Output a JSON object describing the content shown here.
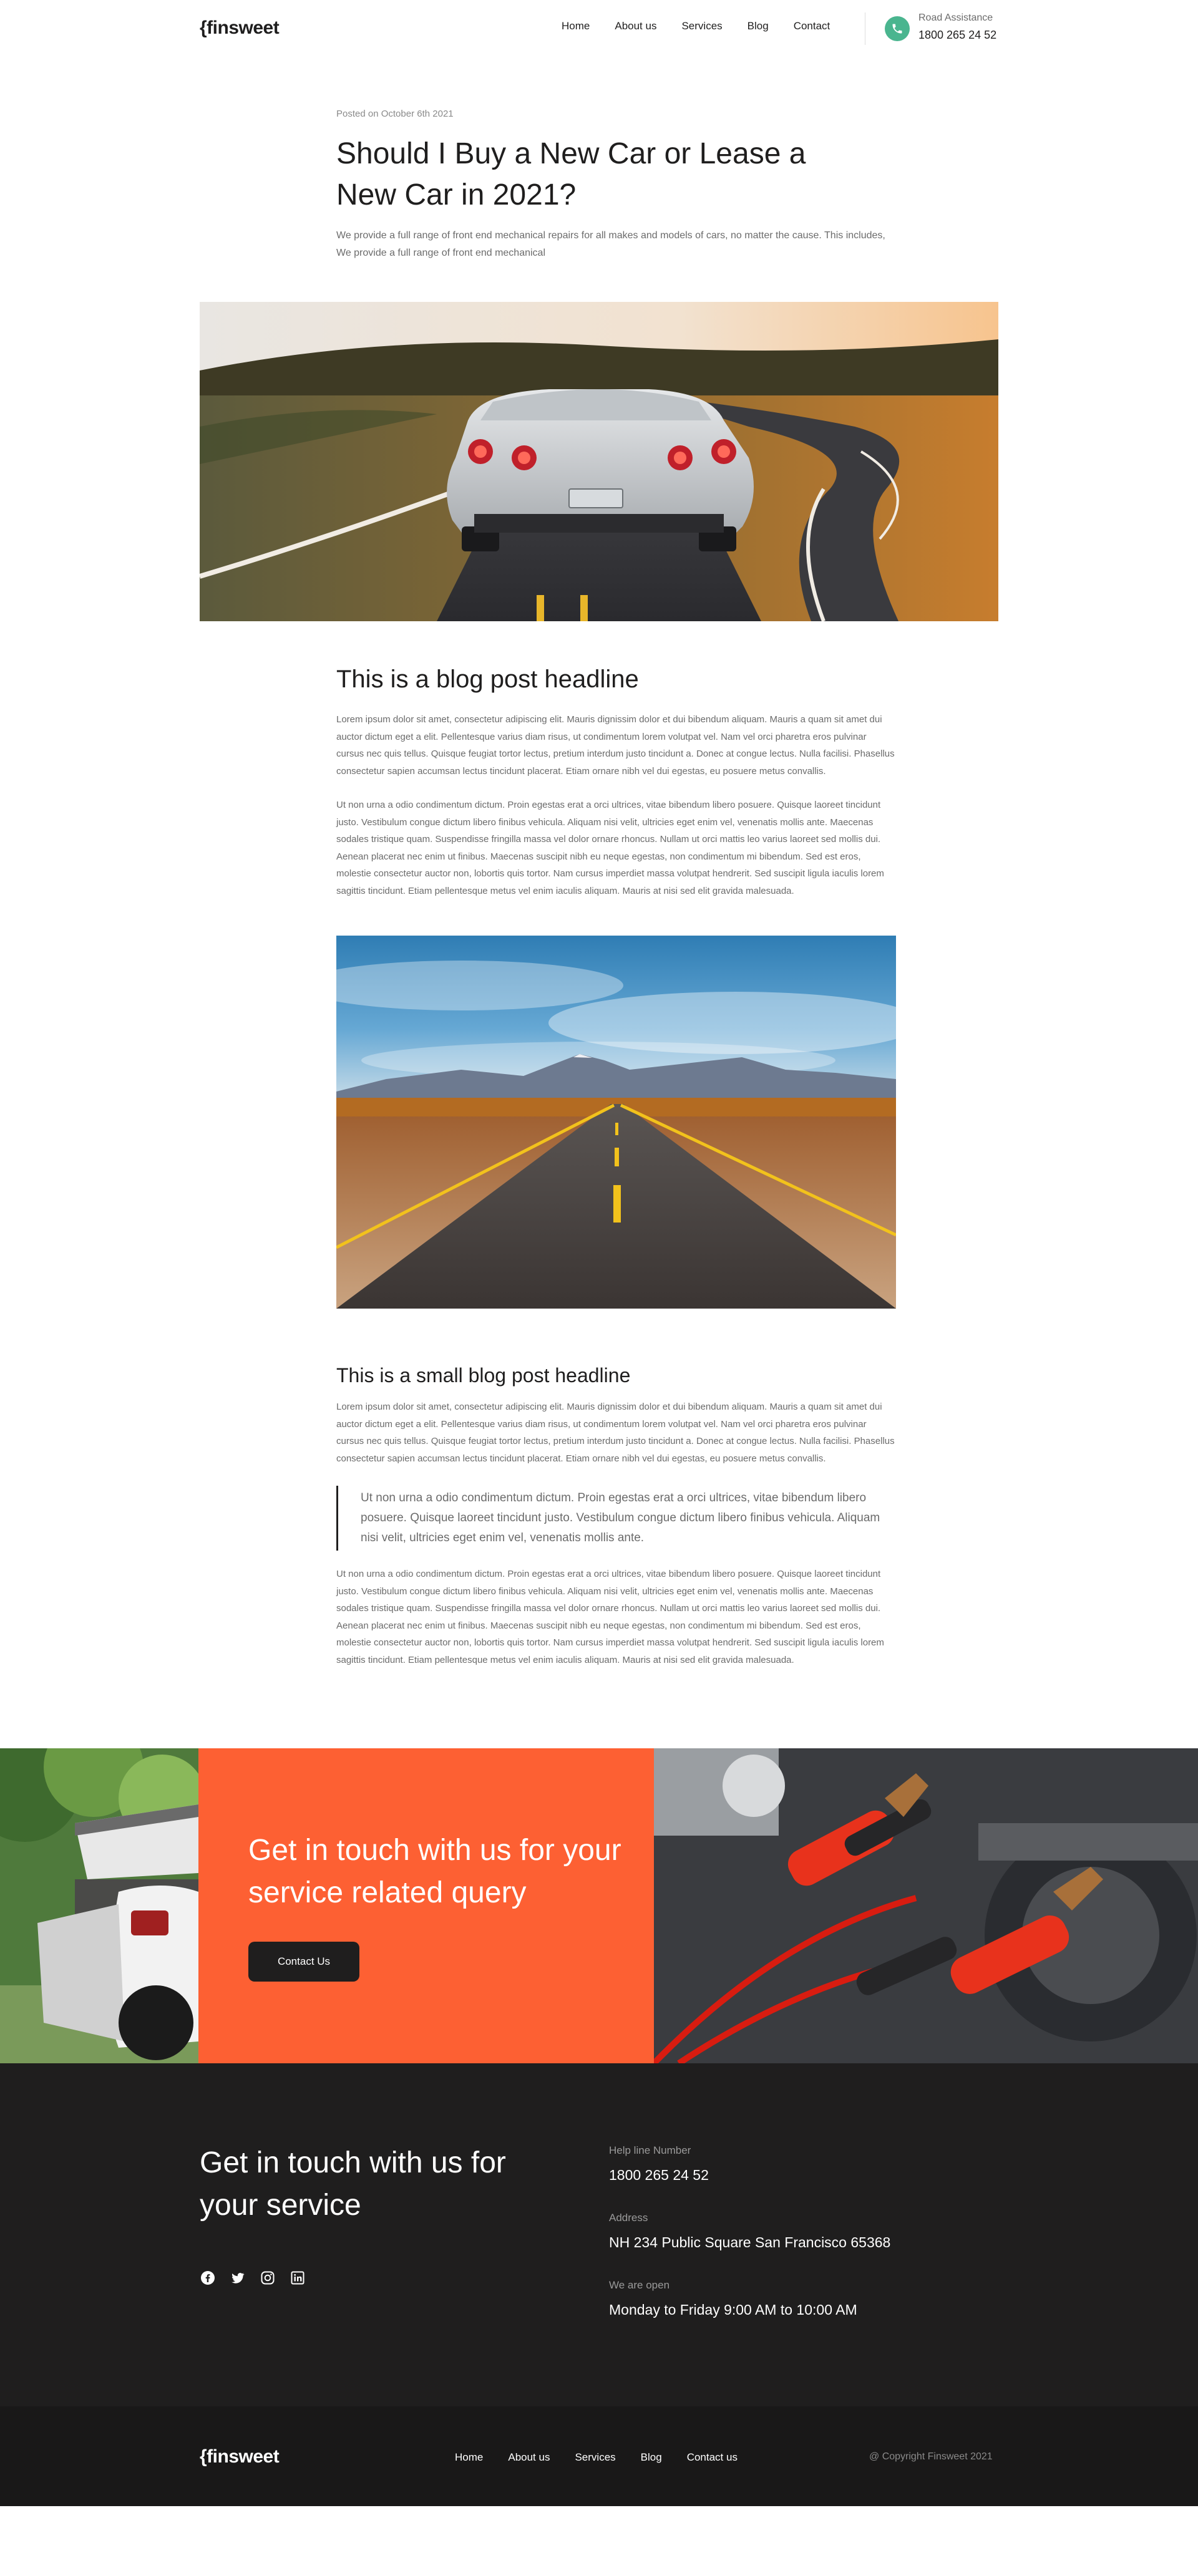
{
  "header": {
    "logo": "{finsweet",
    "nav": [
      "Home",
      "About us",
      "Services",
      "Blog",
      "Contact"
    ],
    "assist_label": "Road Assistance",
    "assist_phone": "1800 265 24 52",
    "phone_icon": "phone-icon"
  },
  "post": {
    "date": "Posted on October 6th 2021",
    "title": "Should I Buy a New Car or Lease a New Car in 2021?",
    "lead": "We provide a full range of front end mechanical repairs for all makes and models of cars, no matter the cause. This includes, We provide a full range of front end mechanical"
  },
  "article": {
    "headline": "This is a blog post headline",
    "para1": "Lorem ipsum dolor sit amet, consectetur adipiscing elit. Mauris dignissim dolor et dui bibendum aliquam. Mauris a quam sit amet dui auctor dictum eget a elit. Pellentesque varius diam risus, ut condimentum lorem volutpat vel. Nam vel orci pharetra eros pulvinar cursus nec quis tellus. Quisque feugiat tortor lectus, pretium interdum justo tincidunt a. Donec at congue lectus. Nulla facilisi. Phasellus consectetur sapien accumsan lectus tincidunt placerat. Etiam ornare nibh vel dui egestas, eu posuere metus convallis.",
    "para2": "Ut non urna a odio condimentum dictum. Proin egestas erat a orci ultrices, vitae bibendum libero posuere. Quisque laoreet tincidunt justo. Vestibulum congue dictum libero finibus vehicula. Aliquam nisi velit, ultricies eget enim vel, venenatis mollis ante. Maecenas sodales tristique quam. Suspendisse fringilla massa vel dolor ornare rhoncus. Nullam ut orci mattis leo varius laoreet sed mollis dui. Aenean placerat nec enim ut finibus. Maecenas suscipit nibh eu neque egestas, non condimentum mi bibendum. Sed est eros, molestie consectetur auctor non, lobortis quis tortor. Nam cursus imperdiet massa volutpat hendrerit. Sed suscipit ligula iaculis lorem sagittis tincidunt. Etiam pellentesque metus vel enim iaculis aliquam. Mauris at nisi sed elit gravida malesuada.",
    "small_headline": "This is a small blog post headline",
    "para3": "Lorem ipsum dolor sit amet, consectetur adipiscing elit. Mauris dignissim dolor et dui bibendum aliquam. Mauris a quam sit amet dui auctor dictum eget a elit. Pellentesque varius diam risus, ut condimentum lorem volutpat vel. Nam vel orci pharetra eros pulvinar cursus nec quis tellus. Quisque feugiat tortor lectus, pretium interdum justo tincidunt a. Donec at congue lectus. Nulla facilisi. Phasellus consectetur sapien accumsan lectus tincidunt placerat. Etiam ornare nibh vel dui egestas, eu posuere metus convallis.",
    "quote": "Ut non urna a odio condimentum dictum. Proin egestas erat a orci ultrices, vitae bibendum libero posuere. Quisque laoreet tincidunt justo. Vestibulum congue dictum libero finibus vehicula. Aliquam nisi velit, ultricies eget enim vel, venenatis mollis ante.",
    "para4": "Ut non urna a odio condimentum dictum. Proin egestas erat a orci ultrices, vitae bibendum libero posuere. Quisque laoreet tincidunt justo. Vestibulum congue dictum libero finibus vehicula. Aliquam nisi velit, ultricies eget enim vel, venenatis mollis ante. Maecenas sodales tristique quam. Suspendisse fringilla massa vel dolor ornare rhoncus. Nullam ut orci mattis leo varius laoreet sed mollis dui. Aenean placerat nec enim ut finibus. Maecenas suscipit nibh eu neque egestas, non condimentum mi bibendum. Sed est eros, molestie consectetur auctor non, lobortis quis tortor. Nam cursus imperdiet massa volutpat hendrerit. Sed suscipit ligula iaculis lorem sagittis tincidunt. Etiam pellentesque metus vel enim iaculis aliquam. Mauris at nisi sed elit gravida malesuada."
  },
  "cta": {
    "title": "Get in touch with us for your service related query",
    "button": "Contact Us"
  },
  "contact": {
    "title": "Get in touch with us for your  service",
    "socials": [
      "facebook-icon",
      "twitter-icon",
      "instagram-icon",
      "linkedin-icon"
    ],
    "helpline_label": "Help line Number",
    "helpline_value": "1800 265 24 52",
    "address_label": "Address",
    "address_value": "NH 234  Public Square San Francisco  65368",
    "hours_label": "We are open",
    "hours_value": "Monday to Friday 9:00 AM to  10:00  AM"
  },
  "footer": {
    "logo": "{finsweet",
    "nav": [
      "Home",
      "About us",
      "Services",
      "Blog",
      "Contact us"
    ],
    "copyright": "@ Copyright Finsweet 2021"
  },
  "colors": {
    "accent_orange": "#fd6033",
    "dark": "#1f1e1e",
    "green": "#4ab58f"
  }
}
